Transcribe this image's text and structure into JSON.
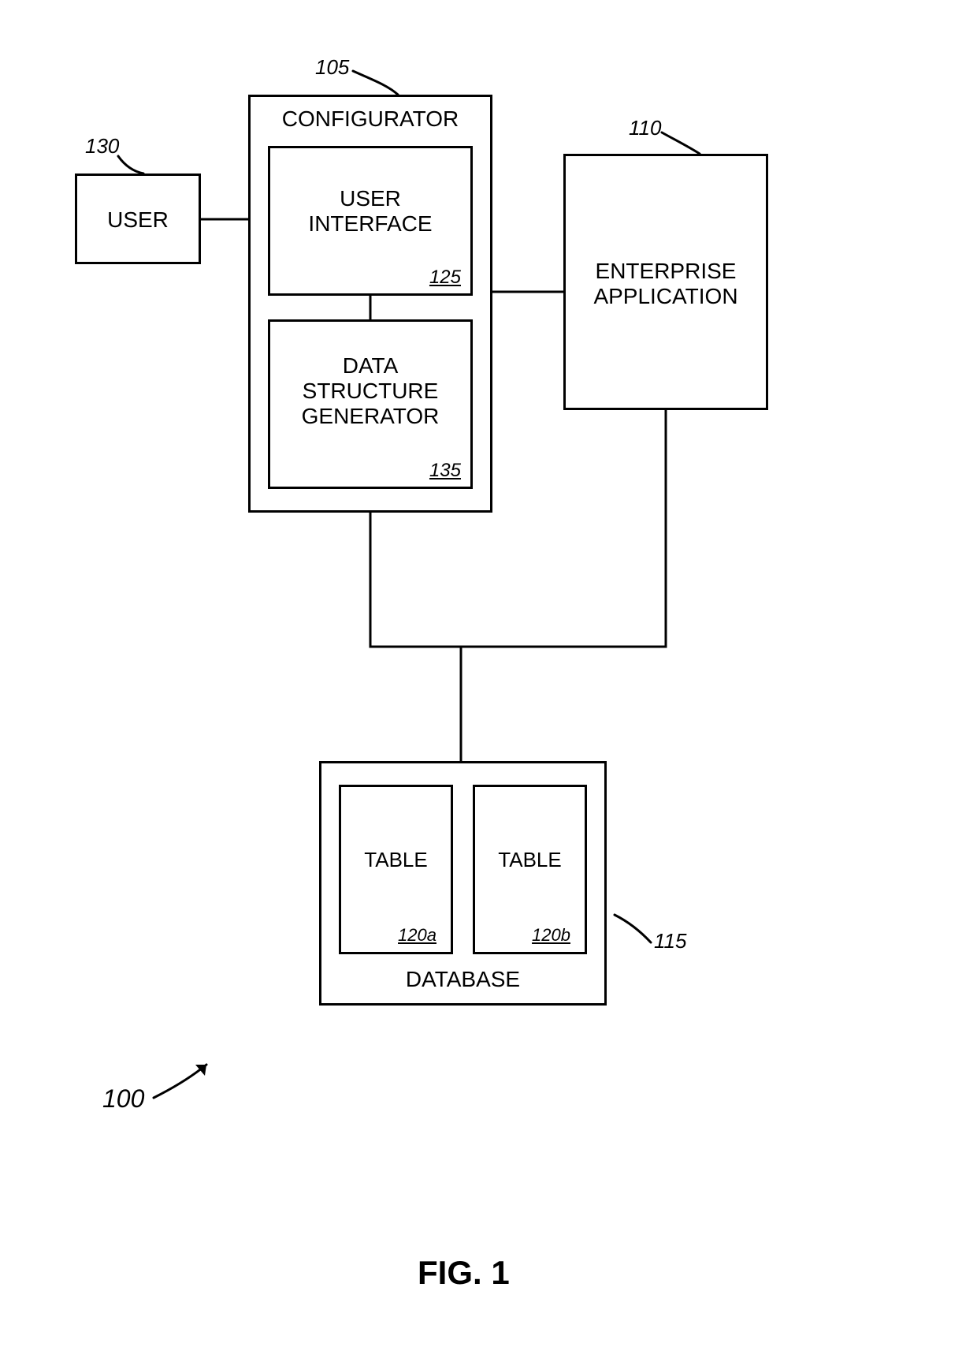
{
  "figure_caption": "FIG. 1",
  "refs": {
    "system": "100",
    "configurator": "105",
    "enterprise": "110",
    "database": "115",
    "table_a": "120a",
    "table_b": "120b",
    "user_interface": "125",
    "user": "130",
    "data_structure_generator": "135"
  },
  "boxes": {
    "user": "USER",
    "configurator": "CONFIGURATOR",
    "user_interface": "USER\nINTERFACE",
    "data_structure_generator": "DATA\nSTRUCTURE\nGENERATOR",
    "enterprise_app": "ENTERPRISE\nAPPLICATION",
    "database": "DATABASE",
    "table_a": "TABLE",
    "table_b": "TABLE"
  }
}
